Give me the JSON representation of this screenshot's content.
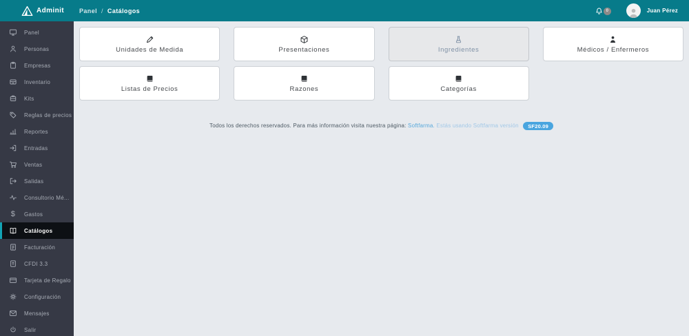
{
  "header": {
    "brand": "Adminit",
    "breadcrumb": {
      "parent": "Panel",
      "separator": "/",
      "current": "Catálogos"
    },
    "notifications_count": "0",
    "user_name": "Juan Pérez"
  },
  "sidebar": {
    "items": [
      {
        "label": "Panel",
        "icon": "monitor-icon",
        "active": false
      },
      {
        "label": "Personas",
        "icon": "person-icon",
        "active": false
      },
      {
        "label": "Empresas",
        "icon": "clipboard-icon",
        "active": false
      },
      {
        "label": "Inventario",
        "icon": "archive-box-icon",
        "active": false
      },
      {
        "label": "Kits",
        "icon": "briefcase-icon",
        "active": false
      },
      {
        "label": "Reglas de precios",
        "icon": "price-tag-icon",
        "active": false
      },
      {
        "label": "Reportes",
        "icon": "bar-chart-icon",
        "active": false
      },
      {
        "label": "Entradas",
        "icon": "arrow-in-icon",
        "active": false
      },
      {
        "label": "Ventas",
        "icon": "shopping-cart-icon",
        "active": false
      },
      {
        "label": "Salidas",
        "icon": "arrow-out-icon",
        "active": false
      },
      {
        "label": "Consultorio Mé...",
        "icon": "pulse-icon",
        "active": false
      },
      {
        "label": "Gastos",
        "icon": "dollar-icon",
        "active": false
      },
      {
        "label": "Catálogos",
        "icon": "open-book-icon",
        "active": true
      },
      {
        "label": "Facturación",
        "icon": "invoice-icon",
        "active": false
      },
      {
        "label": "CFDI 3.3",
        "icon": "document-icon",
        "active": false
      },
      {
        "label": "Tarjeta de Regalo",
        "icon": "card-icon",
        "active": false
      },
      {
        "label": "Configuración",
        "icon": "gear-icon",
        "active": false
      },
      {
        "label": "Mensajes",
        "icon": "mail-icon",
        "active": false
      },
      {
        "label": "Salir",
        "icon": "power-icon",
        "active": false
      }
    ]
  },
  "main": {
    "cards": [
      {
        "label": "Unidades de Medida",
        "icon": "pencil-icon",
        "state": "default"
      },
      {
        "label": "Presentaciones",
        "icon": "package-icon",
        "state": "default"
      },
      {
        "label": "Ingredientes",
        "icon": "flask-icon",
        "state": "highlighted"
      },
      {
        "label": "Médicos / Enfermeros",
        "icon": "doctor-icon",
        "state": "default"
      },
      {
        "label": "Listas de Precios",
        "icon": "book-icon",
        "state": "default"
      },
      {
        "label": "Razones",
        "icon": "book-icon",
        "state": "default"
      },
      {
        "label": "Categorías",
        "icon": "book-icon",
        "state": "default"
      }
    ]
  },
  "footer": {
    "text": "Todos los derechos reservados. Para más información visita nuestra página:",
    "link": "Softfarma.",
    "suffix": "Estás usando Softfarma versión",
    "version_badge": "SF20.09"
  },
  "colors": {
    "header_teal": "#077b8a",
    "sidebar_bg": "#363945",
    "sidebar_active_bg": "#0d1014",
    "active_accent": "#12a3b4",
    "content_bg": "#e7eaee",
    "version_badge_blue": "#49a5df",
    "link_blue": "#57a8db"
  }
}
